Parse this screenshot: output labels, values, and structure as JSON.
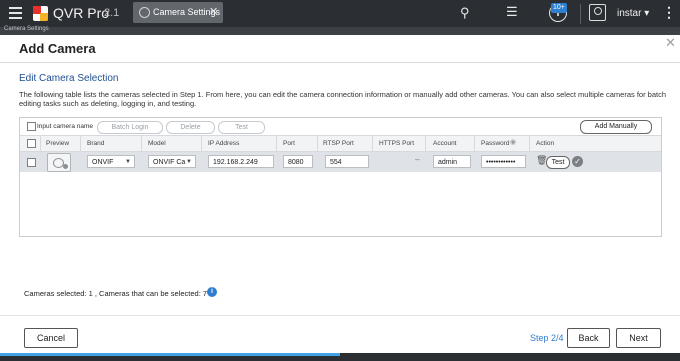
{
  "app": {
    "name": "QVR Pro",
    "version": "2.1",
    "tab_label": "Camera Settings",
    "user": "instar",
    "notif_count": "10+",
    "subbar_text": "Camera Settings"
  },
  "dialog": {
    "title": "Add Camera",
    "section_title": "Edit Camera Selection",
    "description": "The following table lists the cameras selected in Step 1. From here, you can edit the camera connection information or manually add other cameras. You can also select multiple cameras for batch editing tasks such as deleting, logging in, and testing."
  },
  "toolbar": {
    "input_label": "Input camera name",
    "batch_login": "Batch Login",
    "delete": "Delete",
    "test": "Test",
    "add_manually": "Add Manually"
  },
  "columns": [
    "Preview",
    "Brand",
    "Model",
    "IP Address",
    "Port",
    "RTSP Port",
    "HTTPS Port",
    "Account",
    "Password",
    "Action"
  ],
  "row": {
    "brand": "ONVIF",
    "model": "ONVIF Ca",
    "ip": "192.168.2.249",
    "port": "8080",
    "rtsp_port": "554",
    "https_port": "--",
    "account": "admin",
    "password": "••••••••••••",
    "test": "Test"
  },
  "footer": {
    "cameras_selected_label": "Cameras selected:",
    "cameras_selected": "1",
    "can_select_label": ", Cameras that can be selected:",
    "can_select": "7",
    "cancel": "Cancel",
    "step": "Step 2/4",
    "back": "Back",
    "next": "Next"
  },
  "progress": {
    "fraction": 0.5
  },
  "colors": {
    "accent": "#2f7fd1",
    "topbar": "#2b2f34",
    "section_title": "#1d4f91"
  }
}
